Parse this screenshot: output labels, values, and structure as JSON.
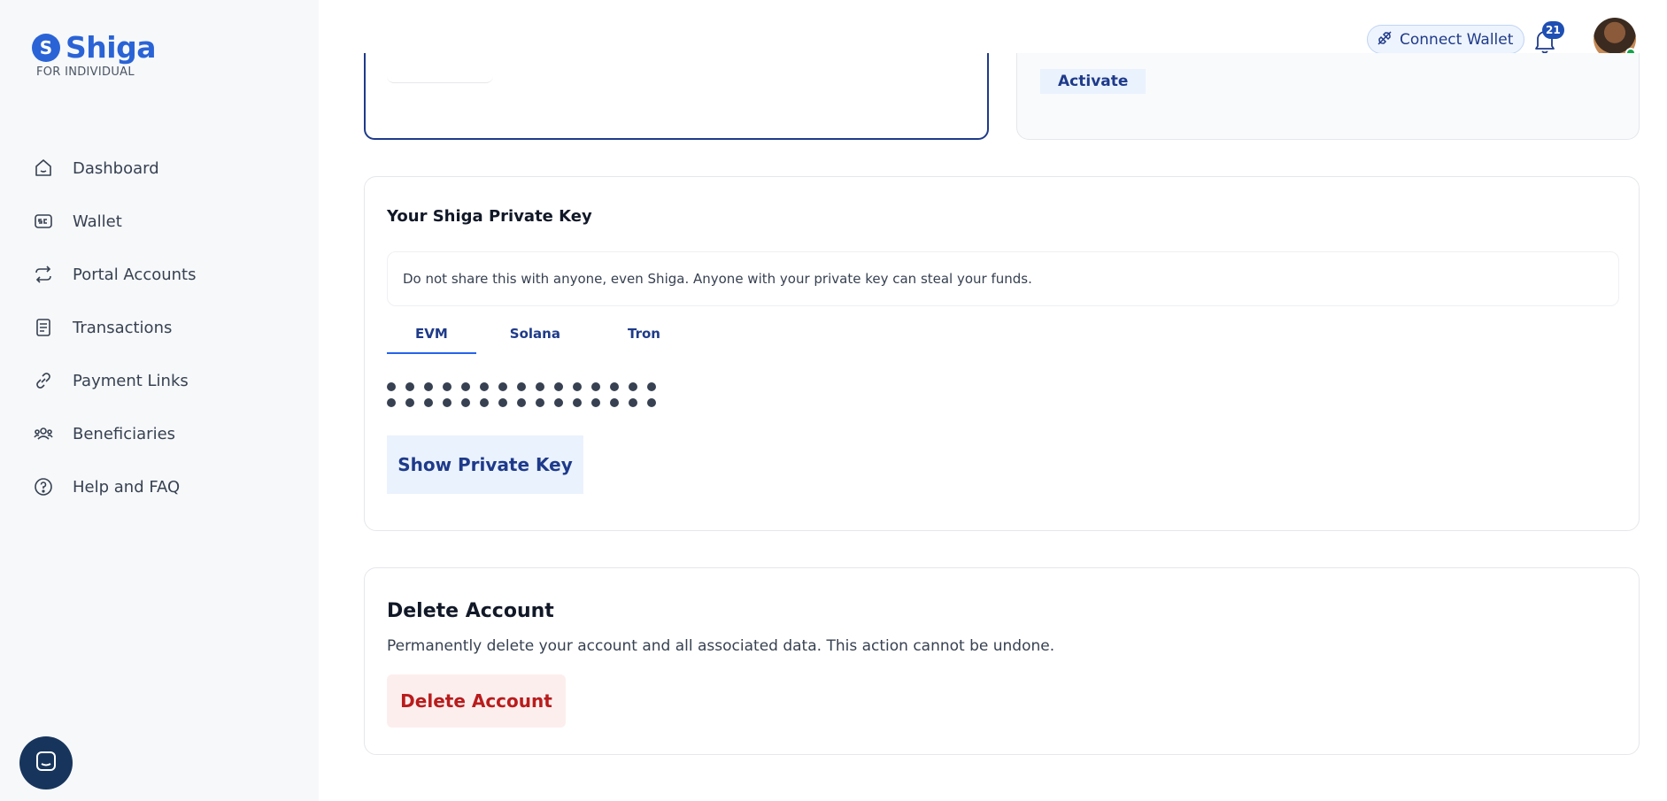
{
  "brand": {
    "name": "Shiga",
    "subtitle": "FOR INDIVIDUAL",
    "accent": "#2a63d6"
  },
  "sidebar": {
    "items": [
      {
        "label": "Dashboard",
        "icon": "home-icon"
      },
      {
        "label": "Wallet",
        "icon": "wallet-icon"
      },
      {
        "label": "Portal Accounts",
        "icon": "transfer-icon"
      },
      {
        "label": "Transactions",
        "icon": "receipt-icon"
      },
      {
        "label": "Payment Links",
        "icon": "link-icon"
      },
      {
        "label": "Beneficiaries",
        "icon": "people-icon"
      },
      {
        "label": "Help and FAQ",
        "icon": "help-icon"
      }
    ]
  },
  "header": {
    "connect_wallet_label": "Connect Wallet",
    "notification_count": "21"
  },
  "top_cards": {
    "activate_label": "Activate"
  },
  "private_key": {
    "title": "Your Shiga Private Key",
    "warning": "Do not share this with anyone, even Shiga. Anyone with your private key can steal your funds.",
    "tabs": [
      {
        "label": "EVM",
        "active": true
      },
      {
        "label": "Solana",
        "active": false
      },
      {
        "label": "Tron",
        "active": false
      }
    ],
    "show_button_label": "Show Private Key"
  },
  "delete_account": {
    "title": "Delete Account",
    "description": "Permanently delete your account and all associated data. This action cannot be undone.",
    "button_label": "Delete Account",
    "danger_color": "#b91c1c"
  }
}
